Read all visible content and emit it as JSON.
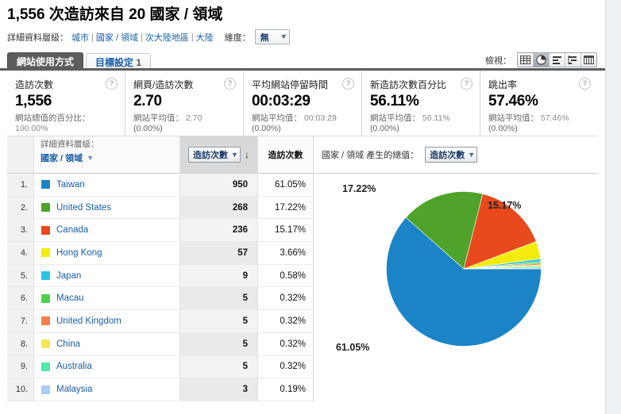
{
  "header": {
    "title": "1,556 次造訪來自 20 國家 / 領域",
    "detail_level_label": "詳細資料層級：",
    "crumbs": [
      "城市",
      "國家 / 領域",
      "次大陸地區",
      "大陸"
    ],
    "dimension_label": "維度：",
    "dimension_value": "無"
  },
  "tabs": [
    {
      "label": "網站使用方式",
      "active": true,
      "badge": ""
    },
    {
      "label": "目標設定",
      "active": false,
      "badge": "1"
    }
  ],
  "view_switcher": {
    "label": "檢視：",
    "icons": [
      "table-view-icon",
      "pie-view-icon",
      "bar-view-icon",
      "comparison-view-icon",
      "pivot-view-icon"
    ],
    "selected_index": 1
  },
  "metrics": [
    {
      "name": "造訪次數",
      "value": "1,556",
      "sub_label": "網站總值的百分比：",
      "sub_value": "",
      "sub_extra": "100.00%",
      "help": "?"
    },
    {
      "name": "網頁/造訪次數",
      "value": "2.70",
      "sub_label": "網站平均值：",
      "sub_value": "2.70",
      "sub_extra": "(0.00%)",
      "help": "?"
    },
    {
      "name": "平均網站停留時間",
      "value": "00:03:29",
      "sub_label": "網站平均值：",
      "sub_value": "00:03:29",
      "sub_extra": "(0.00%)",
      "help": "?"
    },
    {
      "name": "新造訪次數百分比",
      "value": "56.11%",
      "sub_label": "網站平均值：",
      "sub_value": "56.11%",
      "sub_extra": "(0.00%)",
      "help": "?"
    },
    {
      "name": "跳出率",
      "value": "57.46%",
      "sub_label": "網站平均值：",
      "sub_value": "57.46%",
      "sub_extra": "(0.00%)",
      "help": "?"
    }
  ],
  "table": {
    "detail_level_caption": "詳細資料層級：",
    "dimension_pill": "國家 / 領域",
    "sort_metric": "造訪次數",
    "sort_direction": "descending",
    "sort_arrow_glyph": "↓",
    "value_column_header": "造訪次數",
    "rows": [
      {
        "index": "1.",
        "name": "Taiwan",
        "visits": "950",
        "percent": "61.05%",
        "color": "#1b84c6"
      },
      {
        "index": "2.",
        "name": "United States",
        "visits": "268",
        "percent": "17.22%",
        "color": "#4fa32a"
      },
      {
        "index": "3.",
        "name": "Canada",
        "visits": "236",
        "percent": "15.17%",
        "color": "#e8491d"
      },
      {
        "index": "4.",
        "name": "Hong Kong",
        "visits": "57",
        "percent": "3.66%",
        "color": "#f3ec0a"
      },
      {
        "index": "5.",
        "name": "Japan",
        "visits": "9",
        "percent": "0.58%",
        "color": "#2cc4e0"
      },
      {
        "index": "6.",
        "name": "Macau",
        "visits": "5",
        "percent": "0.32%",
        "color": "#4fd04f"
      },
      {
        "index": "7.",
        "name": "United Kingdom",
        "visits": "5",
        "percent": "0.32%",
        "color": "#f28048"
      },
      {
        "index": "8.",
        "name": "China",
        "visits": "5",
        "percent": "0.32%",
        "color": "#f6e65a"
      },
      {
        "index": "9.",
        "name": "Australia",
        "visits": "5",
        "percent": "0.32%",
        "color": "#52e8a5"
      },
      {
        "index": "10.",
        "name": "Malaysia",
        "visits": "3",
        "percent": "0.19%",
        "color": "#a9cdf2"
      }
    ]
  },
  "chart_panel": {
    "title_label": "國家 / 領域 產生的總值：",
    "metric_select": "造訪次數"
  },
  "chart_data": {
    "type": "pie",
    "title": "國家 / 領域 產生的總值：造訪次數",
    "total": 1556,
    "value_unit": "造訪次數",
    "start_angle_deg": 0,
    "direction": "clockwise",
    "categories": [
      "Taiwan",
      "United States",
      "Canada",
      "Hong Kong",
      "Japan",
      "Macau",
      "United Kingdom",
      "China",
      "Australia",
      "Malaysia"
    ],
    "values": [
      950,
      268,
      236,
      57,
      9,
      5,
      5,
      5,
      5,
      3
    ],
    "percents": [
      61.05,
      17.22,
      15.17,
      3.66,
      0.58,
      0.32,
      0.32,
      0.32,
      0.32,
      0.19
    ],
    "colors": [
      "#1b84c6",
      "#4fa32a",
      "#e8491d",
      "#f3ec0a",
      "#2cc4e0",
      "#4fd04f",
      "#f28048",
      "#f6e65a",
      "#52e8a5",
      "#a9cdf2"
    ],
    "visible_labels": [
      {
        "text": "17.22%",
        "series": "United States"
      },
      {
        "text": "15.17%",
        "series": "Canada"
      },
      {
        "text": "61.05%",
        "series": "Taiwan"
      }
    ],
    "legend": "none",
    "grid": false
  }
}
